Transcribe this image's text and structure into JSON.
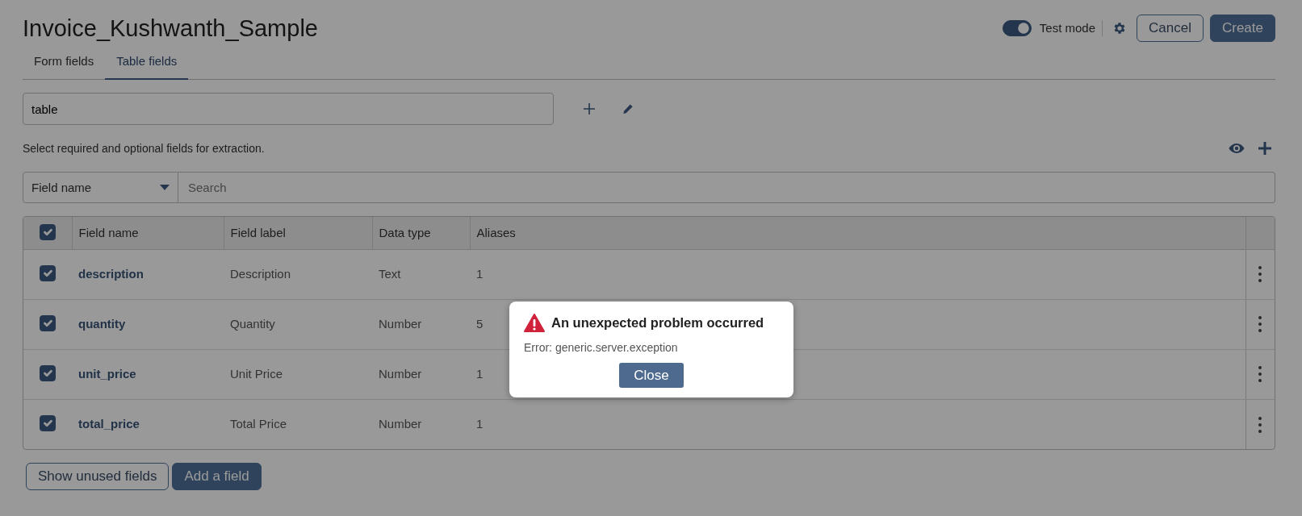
{
  "title": "Invoice_Kushwanth_Sample",
  "test_mode": {
    "label": "Test mode",
    "on": true
  },
  "header_buttons": [
    {
      "label": "Cancel",
      "kind": "outline"
    },
    {
      "label": "Create",
      "kind": "primary"
    }
  ],
  "tabs": [
    {
      "label": "Form fields",
      "selected": false
    },
    {
      "label": "Table fields",
      "selected": true
    }
  ],
  "table_name": {
    "value": "table"
  },
  "hint": "Select required and optional fields for extraction.",
  "filter": {
    "field": "Field name",
    "placeholder": "Search"
  },
  "table": {
    "all_checked": true,
    "columns": [
      "Field name",
      "Field label",
      "Data type",
      "Aliases"
    ],
    "rows": [
      {
        "checked": true,
        "field_name": "description",
        "field_label": "Description",
        "data_type": "Text",
        "aliases": "1"
      },
      {
        "checked": true,
        "field_name": "quantity",
        "field_label": "Quantity",
        "data_type": "Number",
        "aliases": "5"
      },
      {
        "checked": true,
        "field_name": "unit_price",
        "field_label": "Unit Price",
        "data_type": "Number",
        "aliases": "1"
      },
      {
        "checked": true,
        "field_name": "total_price",
        "field_label": "Total Price",
        "data_type": "Number",
        "aliases": "1"
      }
    ]
  },
  "footer_buttons": [
    {
      "label": "Show unused fields",
      "kind": "outline"
    },
    {
      "label": "Add a field",
      "kind": "primary"
    }
  ],
  "dialog": {
    "title": "An unexpected problem occurred",
    "message": "Error: generic.server.exception",
    "button": "Close"
  }
}
